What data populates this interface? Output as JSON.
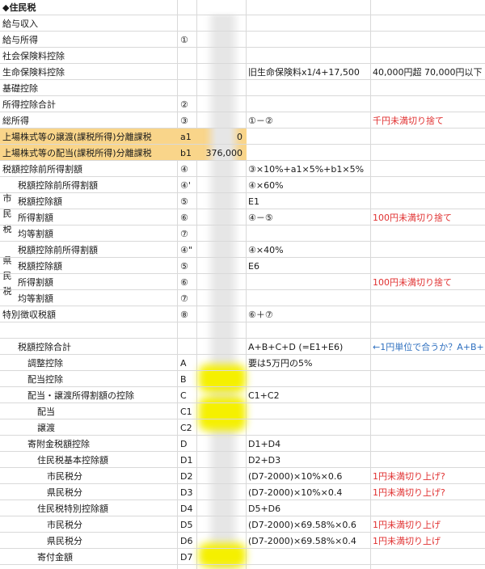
{
  "title": "◆住民税",
  "side_labels": {
    "city": [
      "市",
      "民",
      "税"
    ],
    "pref": [
      "県",
      "民",
      "税"
    ]
  },
  "rows": [
    {
      "label": "給与収入",
      "code": "",
      "value": "",
      "formula": "",
      "note": ""
    },
    {
      "label": "給与所得",
      "code": "①",
      "value": "",
      "formula": "",
      "note": ""
    },
    {
      "label": "社会保険料控除",
      "code": "",
      "value": "",
      "formula": "",
      "note": ""
    },
    {
      "label": "生命保険料控除",
      "code": "",
      "value": "",
      "formula": "旧生命保険料x1/4+17,500",
      "note": "40,000円超 70,000円以下"
    },
    {
      "label": "基礎控除",
      "code": "",
      "value": "",
      "formula": "",
      "note": ""
    },
    {
      "label": "所得控除合計",
      "code": "②",
      "value": "",
      "formula": "",
      "note": ""
    },
    {
      "label": "総所得",
      "code": "③",
      "value": "",
      "formula": "①－②",
      "note": "千円未満切り捨て"
    },
    {
      "label": "上場株式等の譲渡(課税所得)分離課税",
      "code": "a1",
      "value": "0",
      "formula": "",
      "note": ""
    },
    {
      "label": "上場株式等の配当(課税所得)分離課税",
      "code": "b1",
      "value": "376,000",
      "formula": "",
      "note": ""
    },
    {
      "label": "税額控除前所得割額",
      "code": "④",
      "value": "",
      "formula": "③×10%+a1×5%+b1×5%",
      "note": ""
    },
    {
      "label": "税額控除前所得割額",
      "code": "④'",
      "value": "",
      "formula": "④×60%",
      "note": ""
    },
    {
      "label": "税額控除額",
      "code": "⑤",
      "value": "",
      "formula": "E1",
      "note": ""
    },
    {
      "label": "所得割額",
      "code": "⑥",
      "value": "",
      "formula": "④－⑤",
      "note": "100円未満切り捨て"
    },
    {
      "label": "均等割額",
      "code": "⑦",
      "value": "",
      "formula": "",
      "note": ""
    },
    {
      "label": "税額控除前所得割額",
      "code": "④\"",
      "value": "",
      "formula": "④×40%",
      "note": ""
    },
    {
      "label": "税額控除額",
      "code": "⑤",
      "value": "",
      "formula": "E6",
      "note": ""
    },
    {
      "label": "所得割額",
      "code": "⑥",
      "value": "",
      "formula": "",
      "note": "100円未満切り捨て"
    },
    {
      "label": "均等割額",
      "code": "⑦",
      "value": "",
      "formula": "",
      "note": ""
    },
    {
      "label": "特別徴収税額",
      "code": "⑧",
      "value": "",
      "formula": "⑥＋⑦",
      "note": ""
    },
    {
      "label": "",
      "code": "",
      "value": "",
      "formula": "",
      "note": ""
    },
    {
      "label": "税額控除合計",
      "code": "",
      "value": "",
      "formula": "A+B+C+D (=E1+E6)",
      "note": "←1円単位で合うか？A+B+"
    },
    {
      "label": "調整控除",
      "code": "A",
      "value": "",
      "formula": "要は5万円の5%",
      "note": ""
    },
    {
      "label": "配当控除",
      "code": "B",
      "value": "",
      "formula": "",
      "note": ""
    },
    {
      "label": "配当・譲渡所得割額の控除",
      "code": "C",
      "value": "",
      "formula": "C1+C2",
      "note": ""
    },
    {
      "label": "配当",
      "code": "C1",
      "value": "",
      "formula": "",
      "note": ""
    },
    {
      "label": "譲渡",
      "code": "C2",
      "value": "",
      "formula": "",
      "note": ""
    },
    {
      "label": "寄附金税額控除",
      "code": "D",
      "value": "",
      "formula": "D1+D4",
      "note": ""
    },
    {
      "label": "住民税基本控除額",
      "code": "D1",
      "value": "",
      "formula": "D2+D3",
      "note": ""
    },
    {
      "label": "市民税分",
      "code": "D2",
      "value": "",
      "formula": "(D7-2000)×10%×0.6",
      "note": "1円未満切り上げ?"
    },
    {
      "label": "県民税分",
      "code": "D3",
      "value": "",
      "formula": "(D7-2000)×10%×0.4",
      "note": "1円未満切り上げ?"
    },
    {
      "label": "住民税特別控除額",
      "code": "D4",
      "value": "",
      "formula": "D5+D6",
      "note": ""
    },
    {
      "label": "市民税分",
      "code": "D5",
      "value": "",
      "formula": "(D7-2000)×69.58%×0.6",
      "note": "1円未満切り上げ"
    },
    {
      "label": "県民税分",
      "code": "D6",
      "value": "",
      "formula": "(D7-2000)×69.58%×0.4",
      "note": "1円未満切り上げ"
    },
    {
      "label": "寄付金額",
      "code": "D7",
      "value": "",
      "formula": "",
      "note": ""
    }
  ],
  "colors": {
    "highlight": "#f9d58a",
    "note_red": "#e03030",
    "note_blue": "#2e6fbf",
    "grid": "#d9d9d9"
  }
}
